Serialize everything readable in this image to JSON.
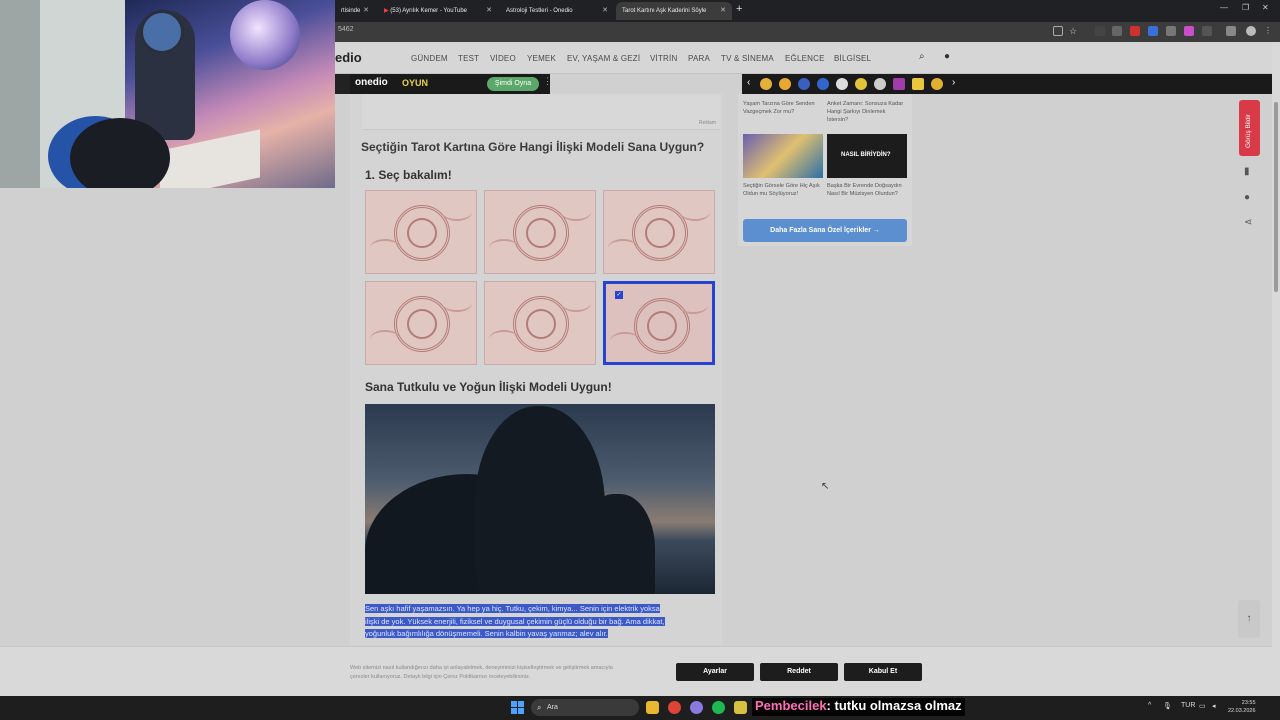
{
  "browser": {
    "tabs": [
      {
        "label": "rtisinde"
      },
      {
        "label": "(53) Ayrılık Kemer - YouTube"
      },
      {
        "label": "Astroloji Testleri - Onedio"
      },
      {
        "label": "Tarot Kartını Aşk Kaderini Söyle"
      }
    ],
    "url": "5462"
  },
  "site": {
    "logo": "edio",
    "nav": [
      "GÜNDEM",
      "TEST",
      "VİDEO",
      "YEMEK",
      "EV, YAŞAM & GEZİ",
      "VİTRİN",
      "PARA",
      "TV & SİNEMA",
      "EĞLENCE",
      "BİLGİSEL"
    ],
    "banner": {
      "logo": "onedio",
      "game": "OYUN",
      "play": "Şimdi Oyna"
    }
  },
  "article": {
    "ad_note": "Reklam",
    "question_title": "Seçtiğin Tarot Kartına Göre Hangi İlişki Modeli Sana Uygun?",
    "step_title": "1. Seç bakalım!",
    "selected_card_index": 5,
    "result_title": "Sana Tutkulu ve Yoğun İlişki Modeli Uygun!",
    "result_lines": [
      "Sen aşkı hafif yaşamazsın. Ya hep ya hiç. Tutku, çekim, kimya... Senin için elektrik yoksa",
      "ilişki de yok. Yüksek enerjili, fiziksel ve duygusal çekimin güçlü olduğu bir bağ. Ama dikkat,",
      "yoğunluk bağımlılığa dönüşmemeli. Senin kalbin yavaş yanmaz; alev alır."
    ]
  },
  "sidebar": {
    "cards": [
      {
        "title": "Yaşam Tarzına Göre Senden Vazgeçmek Zor mu?"
      },
      {
        "title": "Anket Zamanı: Sonsuza Kadar Hangi Şarkıyı Dinlemek İstersin?"
      },
      {
        "title": "Seçtiğin Görsele Göre Hiç Aşık Oldun mu Söylüyoruz!",
        "thumb_color": "#c9a25a"
      },
      {
        "title": "Başka Bir Evrende Doğsaydın Nasıl Bir Müzisyen Olurdun?",
        "thumb_text": "NASIL BİRİYDİN?",
        "thumb_color": "#1c1c1c"
      }
    ],
    "more_button": "Daha Fazla Sana Özel İçerikler →",
    "follow_tab": "Görüş Bildir"
  },
  "cookie": {
    "text_line1": "Web sitemizi nasıl kullandığınızı daha iyi anlayabilmek, deneyiminizi kişiselleştirmek ve geliştirmek amacıyla",
    "text_line2": "çerezler kullanıyoruz. Detaylı bilgi için Çerez Politikamızı inceleyebilirsiniz.",
    "settings": "Ayarlar",
    "reject": "Reddet",
    "accept": "Kabul Et"
  },
  "taskbar": {
    "search": "Ara",
    "lang": "TUR",
    "time": "23:55",
    "date": "22.03.2026"
  },
  "chat": {
    "user": "Pembecilek",
    "message": ": tutku olmazsa olmaz"
  },
  "colors": {
    "accent_blue": "#2643d1",
    "follow_red": "#d83a48",
    "button_blue": "#5b8fcf",
    "chat_user": "#ff6fb5"
  }
}
